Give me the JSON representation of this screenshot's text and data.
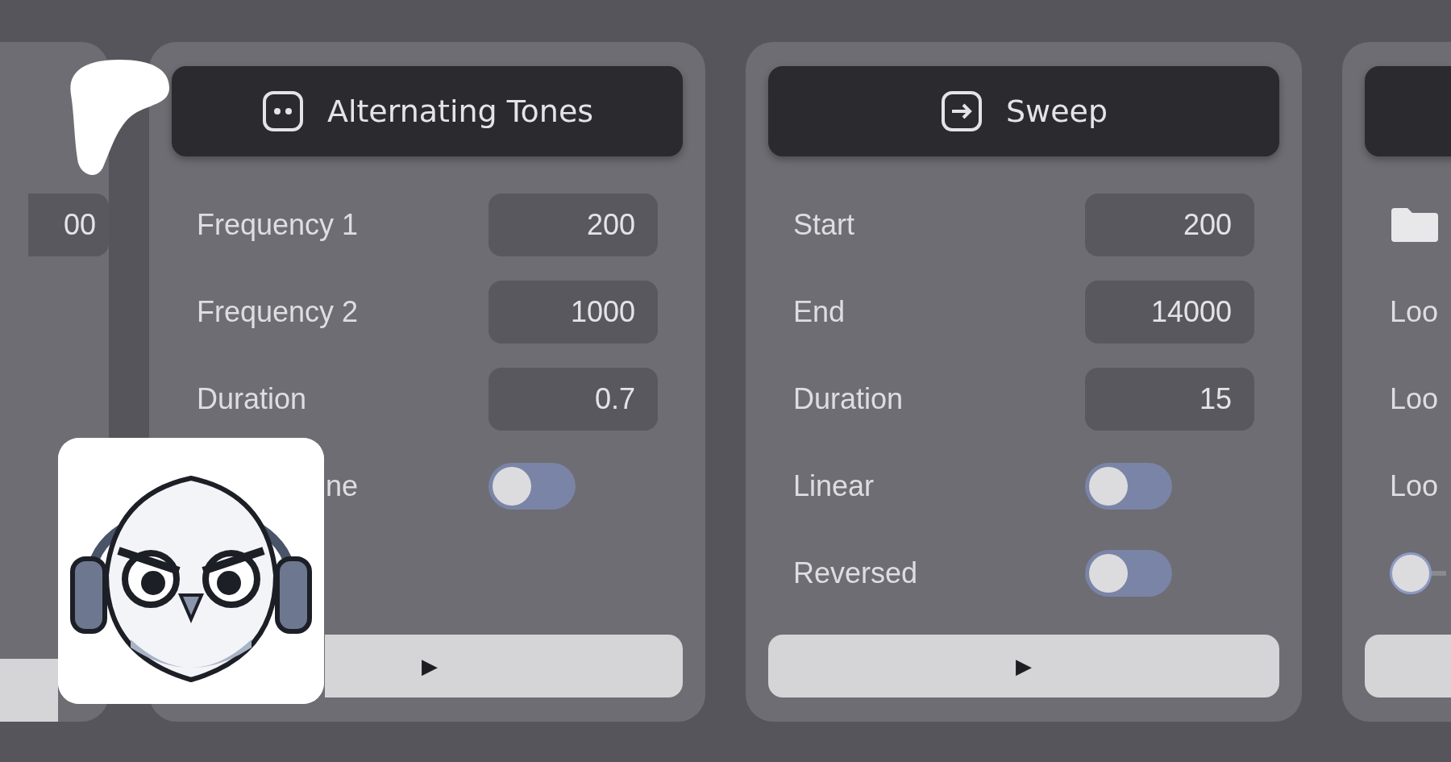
{
  "left_card": {
    "field": {
      "value": "00"
    }
  },
  "cards": [
    {
      "title": "Alternating Tones",
      "rows": [
        {
          "kind": "number",
          "label": "Frequency 1",
          "value": "200"
        },
        {
          "kind": "number",
          "label": "Frequency 2",
          "value": "1000"
        },
        {
          "kind": "number",
          "label": "Duration",
          "value": "0.7"
        },
        {
          "kind": "toggle",
          "label": "ne",
          "on": false
        }
      ],
      "play": "▶"
    },
    {
      "title": "Sweep",
      "rows": [
        {
          "kind": "number",
          "label": "Start",
          "value": "200"
        },
        {
          "kind": "number",
          "label": "End",
          "value": "14000"
        },
        {
          "kind": "number",
          "label": "Duration",
          "value": "15"
        },
        {
          "kind": "toggle",
          "label": "Linear",
          "on": false
        },
        {
          "kind": "toggle",
          "label": "Reversed",
          "on": false
        }
      ],
      "play": "▶"
    }
  ],
  "right_card": {
    "rows": [
      {
        "kind": "folder"
      },
      {
        "kind": "text",
        "label": "Loo"
      },
      {
        "kind": "text",
        "label": "Loo"
      },
      {
        "kind": "text",
        "label": "Loo"
      },
      {
        "kind": "slider",
        "level": 0
      }
    ]
  }
}
